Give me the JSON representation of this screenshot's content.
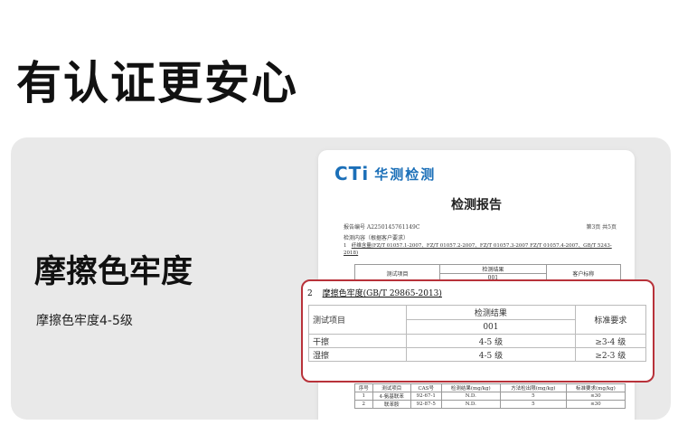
{
  "headline": "有认证更安心",
  "feature": {
    "title": "摩擦色牢度",
    "subtitle": "摩擦色牢度4-5级"
  },
  "report": {
    "logo_text": "CTi",
    "logo_cn": "华测检测",
    "title": "检测报告",
    "report_no": "报告编号    A2250145761149C",
    "page": "第3页  共5页",
    "content_label": "检测内容（根据客户要求）",
    "item1_num": "1",
    "item1_text": "纤维含量(FZ/T 01057.1-2007、FZ/T 01057.2-2007、FZ/T 01057.3-2007 FZ/T 01057.4-2007、GB/T 5243-2018)",
    "bg_headers": [
      "测试项目",
      "检测结果",
      "客户标称"
    ],
    "bg_sample": "001",
    "bottom_headers": [
      "序号",
      "测试项目",
      "CAS号",
      "检测结果(mg/kg)",
      "方法检出限(mg/kg)",
      "标准要求(mg/kg)"
    ],
    "bottom_rows": [
      [
        "1",
        "4-氨基联苯",
        "92-67-1",
        "N.D.",
        "5",
        "≤30"
      ],
      [
        "2",
        "联苯胺",
        "92-87-5",
        "N.D.",
        "5",
        "≤30"
      ]
    ]
  },
  "zoom": {
    "num": "2",
    "heading": "摩擦色牢度(GB/T 29865-2013)",
    "col_item": "测试项目",
    "col_result": "检测结果",
    "col_req": "标准要求",
    "sample": "001",
    "rows": [
      {
        "item": "干擦",
        "result": "4-5 级",
        "req": "≥3-4 级"
      },
      {
        "item": "湿擦",
        "result": "4-5 级",
        "req": "≥2-3 级"
      }
    ]
  },
  "colors": {
    "highlight_border": "#b8323a",
    "logo_blue": "#1b6fb8",
    "card_bg": "#e9e9e9"
  }
}
